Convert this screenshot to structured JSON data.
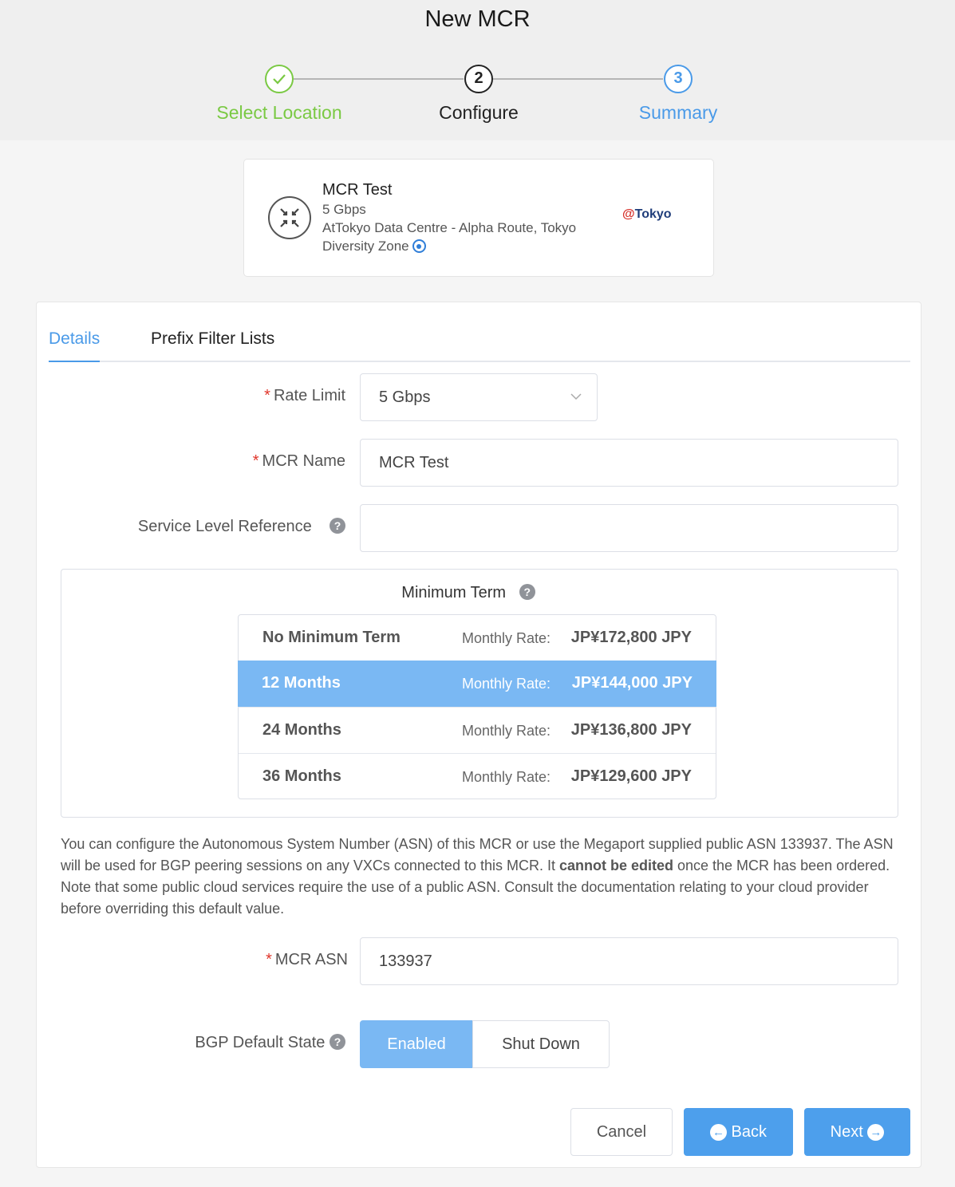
{
  "page": {
    "title": "New MCR"
  },
  "steps": [
    {
      "label": "Select Location",
      "number": "✓",
      "state": "done"
    },
    {
      "label": "Configure",
      "number": "2",
      "state": "active"
    },
    {
      "label": "Summary",
      "number": "3",
      "state": "next"
    }
  ],
  "card": {
    "name": "MCR Test",
    "speed": "5 Gbps",
    "location": "AtTokyo Data Centre - Alpha Route, Tokyo",
    "zone": "Diversity Zone",
    "logo_at": "@",
    "logo_text": "Tokyo"
  },
  "tabs": {
    "details": "Details",
    "prefix": "Prefix Filter Lists"
  },
  "form": {
    "required_mark": "*",
    "rate_limit_label": "Rate Limit",
    "rate_limit_value": "5 Gbps",
    "mcr_name_label": "MCR Name",
    "mcr_name_value": "MCR Test",
    "service_ref_label": "Service Level Reference",
    "help_glyph": "?"
  },
  "term": {
    "title": "Minimum Term",
    "rate_label": "Monthly Rate:",
    "options": [
      {
        "name": "No Minimum Term",
        "rate": "JP¥172,800 JPY",
        "selected": false
      },
      {
        "name": "12 Months",
        "rate": "JP¥144,000 JPY",
        "selected": true
      },
      {
        "name": "24 Months",
        "rate": "JP¥136,800 JPY",
        "selected": false
      },
      {
        "name": "36 Months",
        "rate": "JP¥129,600 JPY",
        "selected": false
      }
    ]
  },
  "asn_info": {
    "before": "You can configure the Autonomous System Number (ASN) of this MCR or use the Megaport supplied public ASN 133937. The ASN will be used for BGP peering sessions on any VXCs connected to this MCR. It ",
    "bold": "cannot be edited",
    "after": " once the MCR has been ordered. Note that some public cloud services require the use of a public ASN. Consult the documentation relating to your cloud provider before overriding this default value."
  },
  "asn": {
    "label": "MCR ASN",
    "value": "133937"
  },
  "bgp": {
    "label": "BGP Default State",
    "enabled": "Enabled",
    "shutdown": "Shut Down",
    "selected": "Enabled"
  },
  "buttons": {
    "cancel": "Cancel",
    "back": "Back",
    "next": "Next",
    "back_glyph": "←",
    "next_glyph": "→"
  },
  "icons": {
    "mcr": "mcr-router-icon",
    "pin": "location-pin-icon",
    "help": "help-icon",
    "chevron": "chevron-down-icon"
  },
  "colors": {
    "accent": "#4a9ae8",
    "done": "#7ac943",
    "selected_row": "#7ab8f3",
    "required": "#e0362b"
  }
}
